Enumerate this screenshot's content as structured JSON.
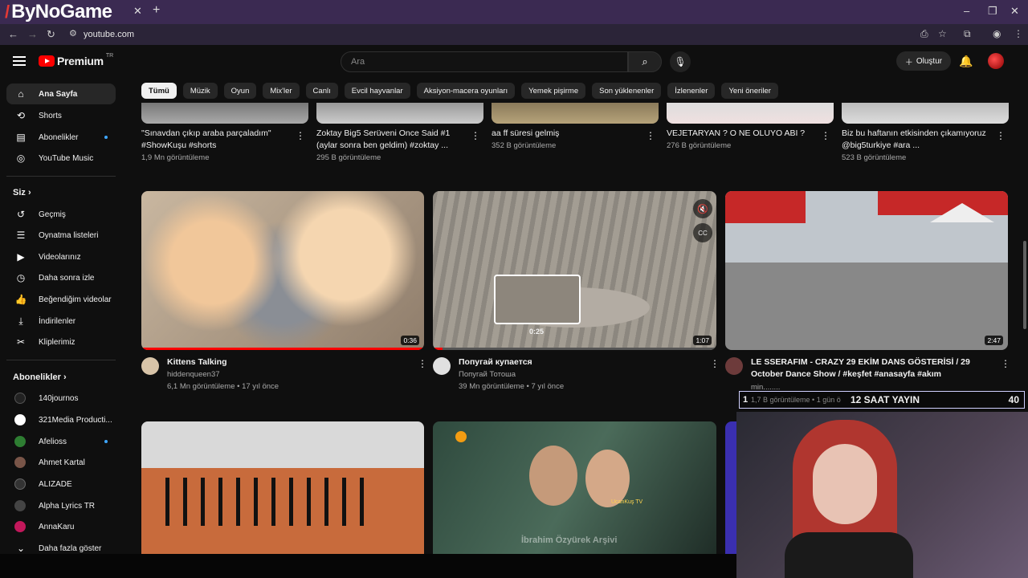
{
  "browser": {
    "brand": "ByNoGame",
    "url": "youtube.com"
  },
  "header": {
    "logo": "Premium",
    "region": "TR",
    "search_placeholder": "Ara",
    "create_label": "Oluştur"
  },
  "sidebar": {
    "main": [
      {
        "label": "Ana Sayfa",
        "icon": "home-icon"
      },
      {
        "label": "Shorts",
        "icon": "shorts-icon"
      },
      {
        "label": "Abonelikler",
        "icon": "subscriptions-icon"
      },
      {
        "label": "YouTube Music",
        "icon": "music-icon"
      }
    ],
    "you_title": "Siz",
    "you": [
      {
        "label": "Geçmiş",
        "icon": "history-icon"
      },
      {
        "label": "Oynatma listeleri",
        "icon": "playlist-icon"
      },
      {
        "label": "Videolarınız",
        "icon": "your-videos-icon"
      },
      {
        "label": "Daha sonra izle",
        "icon": "watch-later-icon"
      },
      {
        "label": "Beğendiğim videolar",
        "icon": "like-icon"
      },
      {
        "label": "İndirilenler",
        "icon": "download-icon"
      },
      {
        "label": "Kliplerimiz",
        "icon": "clips-icon"
      }
    ],
    "subs_title": "Abonelikler",
    "subs": [
      {
        "label": "140journos",
        "color": "#222222"
      },
      {
        "label": "321Media Producti...",
        "color": "#ffffff"
      },
      {
        "label": "Afelioss",
        "color": "#2e7d32"
      },
      {
        "label": "Ahmet Kartal",
        "color": "#795548"
      },
      {
        "label": "ALIZADE",
        "color": "#333333"
      },
      {
        "label": "Alpha Lyrics TR",
        "color": "#444444"
      },
      {
        "label": "AnnaKaru",
        "color": "#c2185b"
      }
    ],
    "more_label": "Daha fazla göster"
  },
  "chips": [
    "Tümü",
    "Müzik",
    "Oyun",
    "Mix'ler",
    "Canlı",
    "Evcil hayvanlar",
    "Aksiyon-macera oyunları",
    "Yemek pişirme",
    "Son yüklenenler",
    "İzlenenler",
    "Yeni öneriler"
  ],
  "shorts_row": [
    {
      "title": "\"Sınavdan çıkıp araba parçaladım\" #ShowKuşu #shorts",
      "meta": "1,9 Mn görüntüleme"
    },
    {
      "title": "Zoktay Big5 Serüveni Once Said #1 (aylar sonra ben geldim) #zoktay ...",
      "meta": "295 B görüntüleme"
    },
    {
      "title": "aa ff süresi gelmiş",
      "meta": "352 B görüntüleme"
    },
    {
      "title": "VEJETARYAN ? O NE OLUYO ABI ?",
      "meta": "276 B görüntüleme"
    },
    {
      "title": "Biz bu haftanın etkisinden çıkamıyoruz @big5turkiye #ara ...",
      "meta": "523 B görüntüleme"
    }
  ],
  "videos": [
    {
      "title": "Kittens Talking",
      "channel": "hiddenqueen37",
      "meta": "6,1 Mn görüntüleme • 17 yıl önce",
      "duration": "0:36"
    },
    {
      "title": "Попугай купается",
      "channel": "Попугай Тотоша",
      "meta": "39 Mn görüntüleme • 7 yıl önce",
      "duration": "1:07",
      "preview_time": "0:25"
    },
    {
      "title": "LE SSERAFIM - CRAZY 29 EKİM DANS GÖSTERİSİ / 29 October Dance Show / #keşfet #anasayfa #akım",
      "channel": "min........",
      "meta": "1,7 B görüntüleme • 1 gün ö",
      "duration": "2:47"
    }
  ],
  "bottom_row": {
    "watermark": "İbrahim Özyürek Arşivi",
    "channel_logo_text": "UcanKuş TV"
  },
  "stream": {
    "label": "12 SAAT YAYIN",
    "count": "40",
    "left_number": "1"
  }
}
